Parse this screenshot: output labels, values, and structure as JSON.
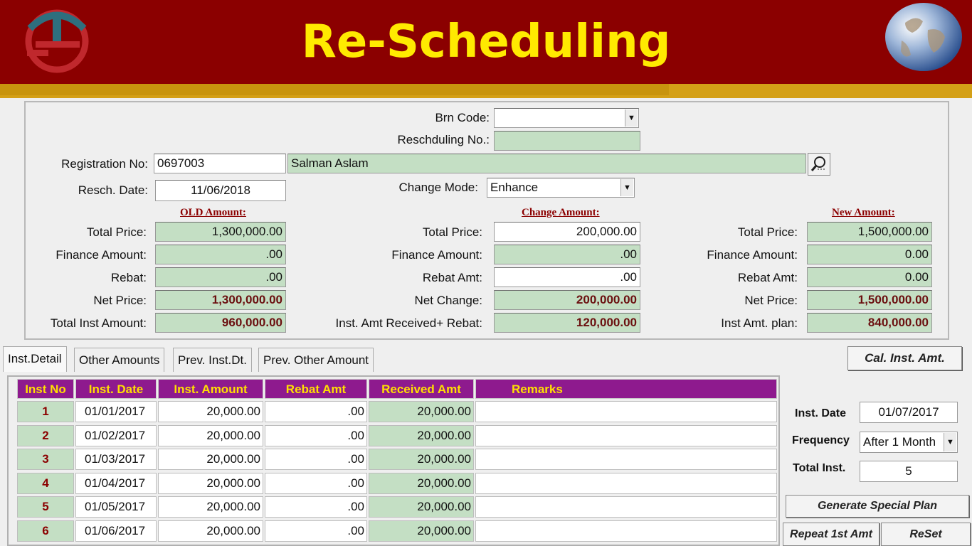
{
  "banner": {
    "title": "Re-Scheduling",
    "logo_icon": "ts-logo-icon",
    "globe_icon": "globe-icon"
  },
  "header": {
    "brn_code_label": "Brn Code:",
    "brn_code_value": "",
    "resch_no_label": "Reschduling No.:",
    "resch_no_value": "",
    "reg_no_label": "Registration No:",
    "reg_no_value": "0697003",
    "customer_name": "Salman Aslam",
    "resch_date_label": "Resch. Date:",
    "resch_date_value": "11/06/2018",
    "change_mode_label": "Change Mode:",
    "change_mode_value": "Enhance"
  },
  "old_amount": {
    "title": "OLD Amount:",
    "rows": [
      {
        "label": "Total Price:",
        "value": "1,300,000.00"
      },
      {
        "label": "Finance Amount:",
        "value": ".00"
      },
      {
        "label": "Rebat:",
        "value": ".00"
      },
      {
        "label": "Net Price:",
        "value": "1,300,000.00"
      },
      {
        "label": "Total Inst Amount:",
        "value": "960,000.00"
      }
    ]
  },
  "change_amount": {
    "title": "Change Amount:",
    "rows": [
      {
        "label": "Total Price:",
        "value": "200,000.00"
      },
      {
        "label": "Finance Amount:",
        "value": ".00"
      },
      {
        "label": "Rebat Amt:",
        "value": ".00"
      },
      {
        "label": "Net Change:",
        "value": "200,000.00"
      },
      {
        "label": "Inst. Amt Received+ Rebat:",
        "value": "120,000.00"
      }
    ]
  },
  "new_amount": {
    "title": "New Amount:",
    "rows": [
      {
        "label": "Total Price:",
        "value": "1,500,000.00"
      },
      {
        "label": "Finance Amount:",
        "value": "0.00"
      },
      {
        "label": "Rebat Amt:",
        "value": "0.00"
      },
      {
        "label": "Net Price:",
        "value": "1,500,000.00"
      },
      {
        "label": "Inst Amt. plan:",
        "value": "840,000.00"
      }
    ]
  },
  "tabs": [
    "Inst.Detail",
    "Other Amounts",
    "Prev. Inst.Dt.",
    "Prev. Other Amount"
  ],
  "cal_button": "Cal. Inst. Amt.",
  "grid": {
    "headers": [
      "Inst No",
      "Inst. Date",
      "Inst. Amount",
      "Rebat Amt",
      "Received Amt",
      "Remarks"
    ],
    "rows": [
      [
        "1",
        "01/01/2017",
        "20,000.00",
        ".00",
        "20,000.00",
        ""
      ],
      [
        "2",
        "01/02/2017",
        "20,000.00",
        ".00",
        "20,000.00",
        ""
      ],
      [
        "3",
        "01/03/2017",
        "20,000.00",
        ".00",
        "20,000.00",
        ""
      ],
      [
        "4",
        "01/04/2017",
        "20,000.00",
        ".00",
        "20,000.00",
        ""
      ],
      [
        "5",
        "01/05/2017",
        "20,000.00",
        ".00",
        "20,000.00",
        ""
      ],
      [
        "6",
        "01/06/2017",
        "20,000.00",
        ".00",
        "20,000.00",
        ""
      ]
    ]
  },
  "side": {
    "inst_date_label": "Inst. Date",
    "inst_date_value": "01/07/2017",
    "frequency_label": "Frequency",
    "frequency_value": "After 1 Month",
    "total_inst_label": "Total Inst.",
    "total_inst_value": "5",
    "generate_button": "Generate Special Plan",
    "repeat_button": "Repeat 1st Amt",
    "reset_button": "ReSet"
  },
  "colors": {
    "banner": "#8b0000",
    "gold": "#d4a017",
    "title": "#ffea00",
    "grid_header": "#8e1a8e",
    "field_green": "#c4dfc4"
  }
}
